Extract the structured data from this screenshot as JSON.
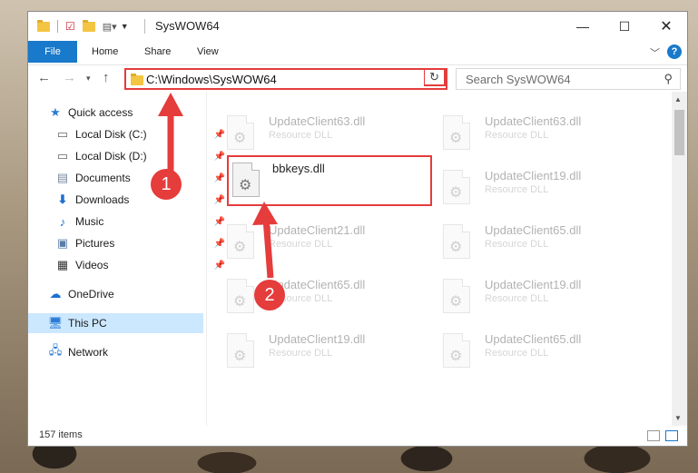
{
  "window": {
    "title": "SysWOW64"
  },
  "ribbon": {
    "tabs": [
      "File",
      "Home",
      "Share",
      "View"
    ],
    "help_label": "?"
  },
  "address": {
    "path": "C:\\Windows\\SysWOW64",
    "search_placeholder": "Search SysWOW64"
  },
  "sidebar": {
    "items": [
      {
        "label": "Quick access",
        "icon": "star-icon",
        "pinned": false
      },
      {
        "label": "Local Disk (C:)",
        "icon": "drive-icon",
        "pinned": true
      },
      {
        "label": "Local Disk (D:)",
        "icon": "drive-icon",
        "pinned": true
      },
      {
        "label": "Documents",
        "icon": "documents-icon",
        "pinned": true
      },
      {
        "label": "Downloads",
        "icon": "download-icon",
        "pinned": true
      },
      {
        "label": "Music",
        "icon": "music-icon",
        "pinned": true
      },
      {
        "label": "Pictures",
        "icon": "pictures-icon",
        "pinned": true
      },
      {
        "label": "Videos",
        "icon": "videos-icon",
        "pinned": true
      },
      {
        "label": "OneDrive",
        "icon": "cloud-icon",
        "pinned": false
      },
      {
        "label": "This PC",
        "icon": "pc-icon",
        "pinned": false,
        "selected": true
      },
      {
        "label": "Network",
        "icon": "network-icon",
        "pinned": false
      }
    ]
  },
  "files": [
    {
      "name": "UpdateClient63.dll",
      "type": "Resource DLL",
      "faded": true
    },
    {
      "name": "UpdateClient63.dll",
      "type": "Resource DLL",
      "faded": true
    },
    {
      "name": "bbkeys.dll",
      "type": "",
      "faded": false
    },
    {
      "name": "UpdateClient19.dll",
      "type": "Resource DLL",
      "faded": true
    },
    {
      "name": "UpdateClient21.dll",
      "type": "Resource DLL",
      "faded": true
    },
    {
      "name": "UpdateClient65.dll",
      "type": "Resource DLL",
      "faded": true
    },
    {
      "name": "UpdateClient65.dll",
      "type": "Resource DLL",
      "faded": true
    },
    {
      "name": "UpdateClient19.dll",
      "type": "Resource DLL",
      "faded": true
    },
    {
      "name": "UpdateClient19.dll",
      "type": "Resource DLL",
      "faded": true
    },
    {
      "name": "UpdateClient65.dll",
      "type": "Resource DLL",
      "faded": true
    }
  ],
  "status": {
    "item_count": "157 items"
  },
  "annotations": {
    "step1": "1",
    "step2": "2",
    "color": "#e53c3c"
  }
}
